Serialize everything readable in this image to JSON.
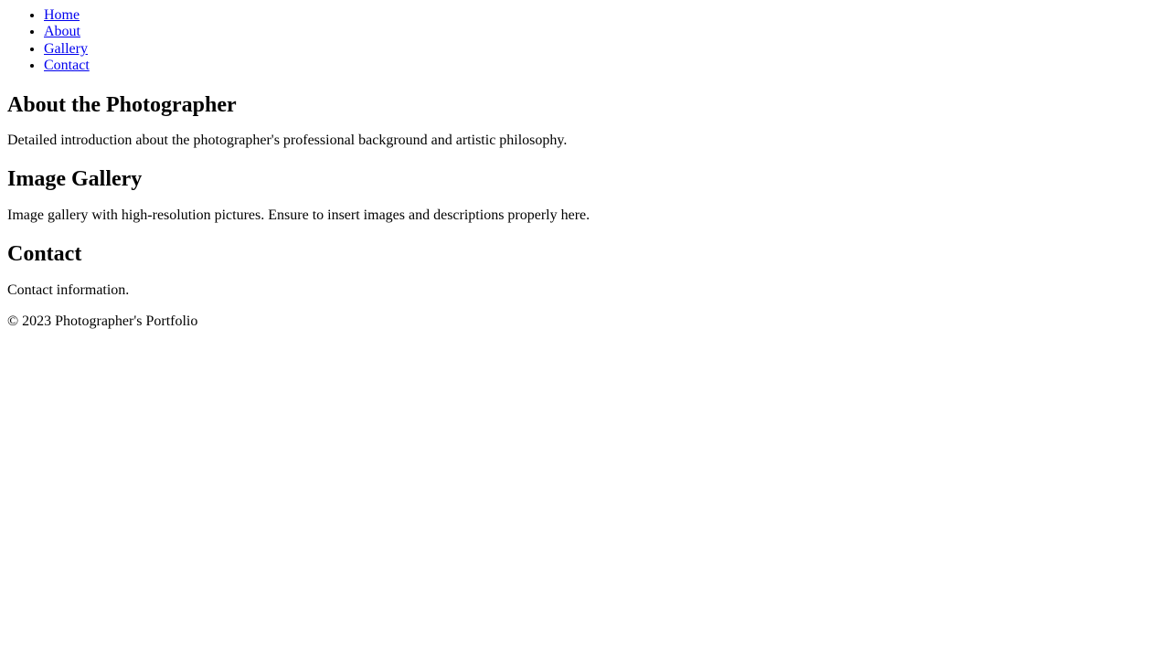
{
  "nav": {
    "items": [
      {
        "label": "Home"
      },
      {
        "label": "About"
      },
      {
        "label": "Gallery"
      },
      {
        "label": "Contact"
      }
    ]
  },
  "about": {
    "heading": "About the Photographer",
    "text": "Detailed introduction about the photographer's professional background and artistic philosophy."
  },
  "gallery": {
    "heading": "Image Gallery",
    "text": "Image gallery with high-resolution pictures. Ensure to insert images and descriptions properly here."
  },
  "contact": {
    "heading": "Contact",
    "text": "Contact information."
  },
  "footer": {
    "text": "© 2023 Photographer's Portfolio"
  },
  "colors": {
    "link": "#0000ee",
    "text": "#000000",
    "background": "#ffffff"
  }
}
